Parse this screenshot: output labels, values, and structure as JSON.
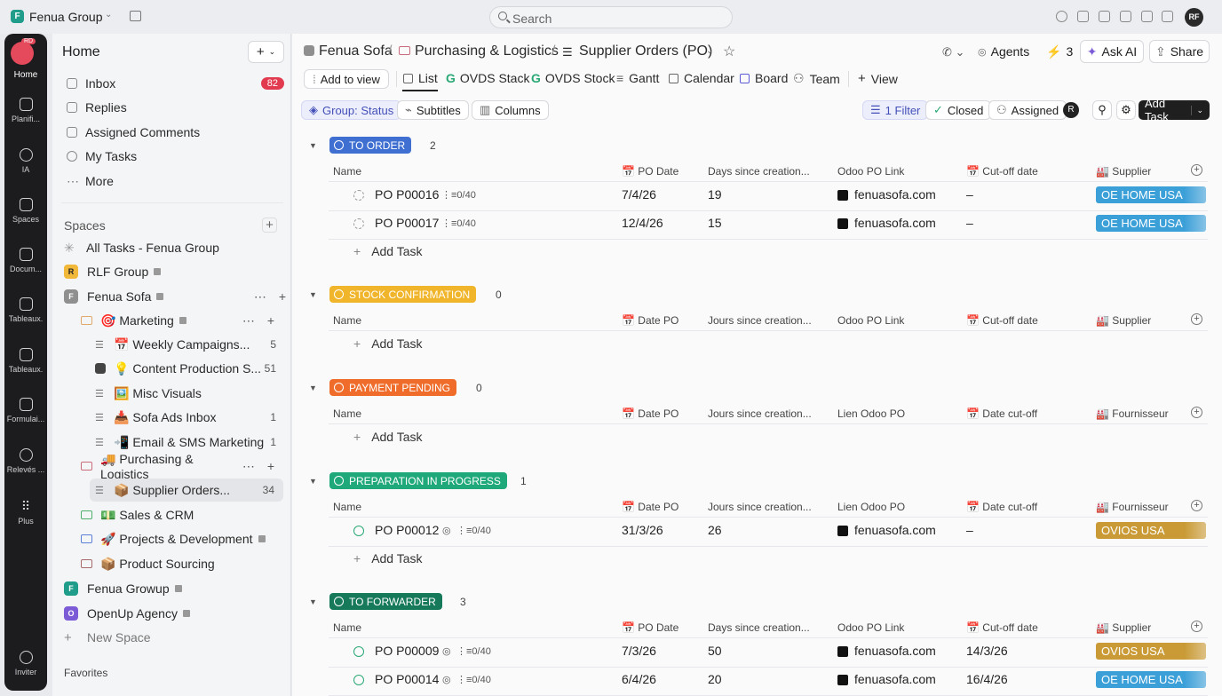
{
  "workspace": {
    "name": "Fenua Group",
    "logo_letter": "F",
    "avatar": "RF"
  },
  "search": {
    "label": "Search"
  },
  "rail": {
    "home_badge": "RD",
    "items": [
      "Home",
      "Planifi...",
      "IA",
      "Spaces",
      "Docum...",
      "Tableaux.",
      "Tableaux.",
      "Formulai...",
      "Relevés ...",
      "Plus"
    ],
    "invite": "Inviter"
  },
  "sidebar": {
    "title": "Home",
    "nav": [
      {
        "label": "Inbox",
        "badge": "82"
      },
      {
        "label": "Replies"
      },
      {
        "label": "Assigned Comments"
      },
      {
        "label": "My Tasks"
      },
      {
        "label": "More"
      }
    ],
    "spaces_label": "Spaces",
    "all_tasks": "All Tasks - Fenua Group",
    "rlf": "RLF Group",
    "fenua_sofa": "Fenua Sofa",
    "marketing": "🎯 Marketing",
    "marketing_items": [
      {
        "label": "📅 Weekly Campaigns...",
        "count": "5"
      },
      {
        "label": "💡 Content Production S...",
        "count": "51"
      },
      {
        "label": "🖼️ Misc Visuals",
        "count": ""
      },
      {
        "label": "📥 Sofa Ads Inbox",
        "count": "1"
      },
      {
        "label": "📲 Email & SMS Marketing",
        "count": "1"
      }
    ],
    "purchasing": "🚚 Purchasing & Logistics",
    "supplier_orders": {
      "label": "📦 Supplier Orders...",
      "count": "34"
    },
    "folders": [
      "💵 Sales & CRM",
      "🚀 Projects & Development",
      "📦 Product Sourcing"
    ],
    "other_spaces": [
      "Fenua Growup",
      "OpenUp Agency"
    ],
    "new_space": "New Space",
    "favorites": "Favorites"
  },
  "breadcrumb": {
    "space": "Fenua Sofa",
    "folder": "Purchasing & Logistics",
    "list": "Supplier Orders (PO)"
  },
  "header_actions": {
    "agents": "Agents",
    "bolt_count": "3",
    "ask_ai": "Ask AI",
    "share": "Share"
  },
  "views": {
    "add": "Add to view",
    "tabs": [
      "List",
      "OVDS Stack",
      "OVDS Stock",
      "Gantt",
      "Calendar",
      "Board",
      "Team"
    ],
    "new_view": "View"
  },
  "toolbar": {
    "group": "Group: Status",
    "subtitles": "Subtitles",
    "columns": "Columns",
    "filter": "1 Filter",
    "closed": "Closed",
    "assigned": "Assigned",
    "assignee_initial": "R",
    "add_task": "Add Task"
  },
  "groups": [
    {
      "name": "TO ORDER",
      "color": "#3f6fd1",
      "count": "2",
      "cols": [
        "Name",
        "📅 PO Date",
        "Days since creation...",
        "Odoo PO Link",
        "📅 Cut-off date",
        "🏭 Supplier"
      ],
      "tasks": [
        {
          "name": "PO P00016",
          "sub": "0/40",
          "date": "7/4/26",
          "days": "19",
          "link": "fenuasofa.com",
          "cutoff": "–",
          "supplier": "OE HOME USA",
          "sup_color": "#3b9fd8"
        },
        {
          "name": "PO P00017",
          "sub": "0/40",
          "date": "12/4/26",
          "days": "15",
          "link": "fenuasofa.com",
          "cutoff": "–",
          "supplier": "OE HOME USA",
          "sup_color": "#3b9fd8"
        }
      ]
    },
    {
      "name": "STOCK CONFIRMATION",
      "color": "#f0b52a",
      "count": "0",
      "cols": [
        "Name",
        "📅 Date PO",
        "Jours since creation...",
        "Odoo PO Link",
        "📅 Cut-off date",
        "🏭 Supplier"
      ],
      "tasks": []
    },
    {
      "name": "PAYMENT PENDING",
      "color": "#ef6c2a",
      "count": "0",
      "cols": [
        "Name",
        "📅 Date PO",
        "Jours since creation...",
        "Lien Odoo PO",
        "📅 Date cut-off",
        "🏭 Fournisseur"
      ],
      "tasks": []
    },
    {
      "name": "PREPARATION IN PROGRESS",
      "color": "#1fa97a",
      "count": "1",
      "cols": [
        "Name",
        "📅 Date PO",
        "Jours since creation...",
        "Lien Odoo PO",
        "📅 Date cut-off",
        "🏭 Fournisseur"
      ],
      "tasks": [
        {
          "name": "PO P00012",
          "sub": "0/40",
          "date": "31/3/26",
          "days": "26",
          "link": "fenuasofa.com",
          "cutoff": "–",
          "supplier": "OVIOS USA",
          "sup_color": "#c99a35"
        }
      ]
    },
    {
      "name": "TO FORWARDER",
      "color": "#167a5a",
      "count": "3",
      "cols": [
        "Name",
        "📅 PO Date",
        "Days since creation...",
        "Odoo PO Link",
        "📅 Cut-off date",
        "🏭 Supplier"
      ],
      "tasks": [
        {
          "name": "PO P00009",
          "sub": "0/40",
          "date": "7/3/26",
          "days": "50",
          "link": "fenuasofa.com",
          "cutoff": "14/3/26",
          "supplier": "OVIOS USA",
          "sup_color": "#c99a35"
        },
        {
          "name": "PO P00014",
          "sub": "0/40",
          "date": "6/4/26",
          "days": "20",
          "link": "fenuasofa.com",
          "cutoff": "16/4/26",
          "supplier": "OE HOME USA",
          "sup_color": "#3b9fd8"
        }
      ]
    }
  ],
  "add_task_label": "Add Task"
}
